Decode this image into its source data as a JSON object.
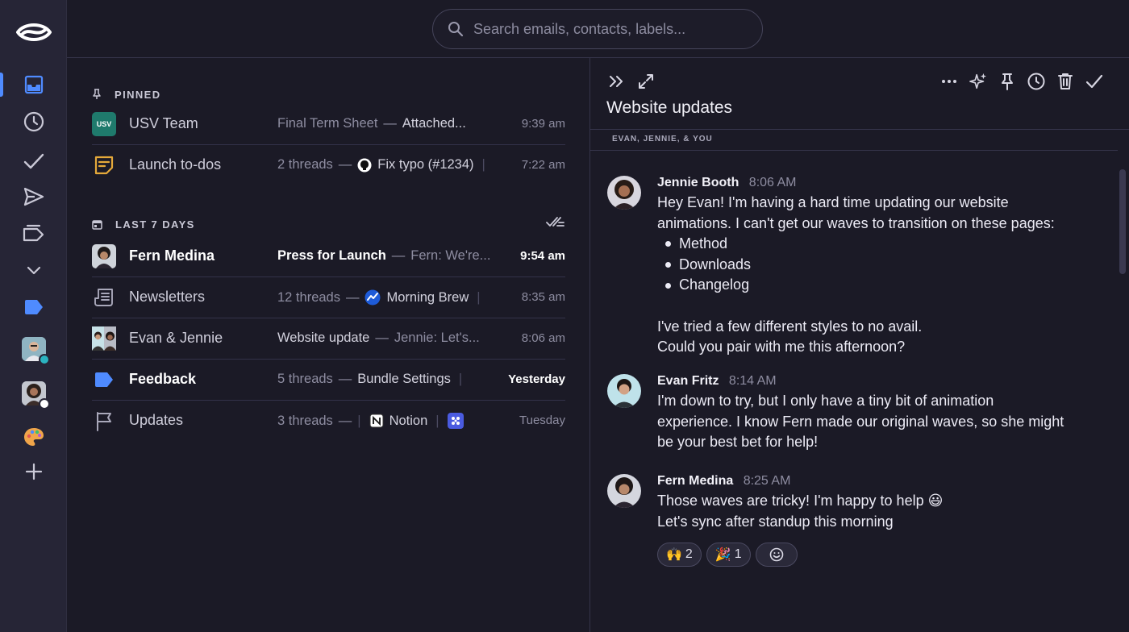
{
  "search": {
    "placeholder": "Search emails, contacts, labels..."
  },
  "sidebar": {
    "items": [
      {
        "name": "inbox-icon"
      },
      {
        "name": "clock-icon"
      },
      {
        "name": "check-icon"
      },
      {
        "name": "send-icon"
      },
      {
        "name": "labels-icon"
      },
      {
        "name": "chevron-down-icon"
      },
      {
        "name": "label-tag-icon"
      },
      {
        "name": "account-avatar-1"
      },
      {
        "name": "account-avatar-2"
      },
      {
        "name": "palette-icon"
      },
      {
        "name": "add-icon"
      }
    ],
    "accent": "#4f8bff"
  },
  "pinned": {
    "title": "PINNED",
    "rows": [
      {
        "name": "USV Team",
        "avatar_text": "USV",
        "subject": "Final Term Sheet",
        "snippet": "Attached...",
        "time": "9:39 am"
      },
      {
        "name": "Launch to-dos",
        "count": "2 threads",
        "chip": "Fix typo (#1234)",
        "time": "7:22 am"
      }
    ]
  },
  "recent": {
    "title": "LAST 7 DAYS",
    "rows": [
      {
        "name": "Fern Medina",
        "subject": "Press for Launch",
        "snippet": "Fern: We're...",
        "time": "9:54 am"
      },
      {
        "name": "Newsletters",
        "count": "12 threads",
        "chip": "Morning Brew",
        "time": "8:35 am"
      },
      {
        "name": "Evan & Jennie",
        "subject": "Website update",
        "snippet": "Jennie: Let's...",
        "time": "8:06 am"
      },
      {
        "name": "Feedback",
        "count": "5 threads",
        "chip": "Bundle Settings",
        "time": "Yesterday"
      },
      {
        "name": "Updates",
        "count": "3 threads",
        "chip": "Notion",
        "time": "Tuesday"
      }
    ]
  },
  "thread": {
    "title": "Website updates",
    "participants": "EVAN, JENNIE, & YOU",
    "messages": [
      {
        "author": "Jennie Booth",
        "time": "8:06 AM",
        "line1": "Hey Evan! I'm having a hard time updating our website",
        "line2": "animations. I can't get our waves to transition on these pages:",
        "bullets": [
          "Method",
          "Downloads",
          "Changelog"
        ],
        "line3": "I've tried a few different styles to no avail.",
        "line4": "Could you pair with me this afternoon?"
      },
      {
        "author": "Evan Fritz",
        "time": "8:14 AM",
        "line1": "I'm down to try, but I only have a tiny bit of animation",
        "line2": "experience. I know Fern made our original waves, so she might",
        "line3": "be your best bet for help!"
      },
      {
        "author": "Fern Medina",
        "time": "8:25 AM",
        "line1": "Those waves are tricky! I'm happy to help 😃",
        "line2": "Let's sync after standup this morning",
        "reactions": [
          {
            "emoji": "🙌",
            "count": "2"
          },
          {
            "emoji": "🎉",
            "count": "1"
          },
          {
            "emoji": "☺",
            "count": ""
          }
        ]
      }
    ]
  }
}
